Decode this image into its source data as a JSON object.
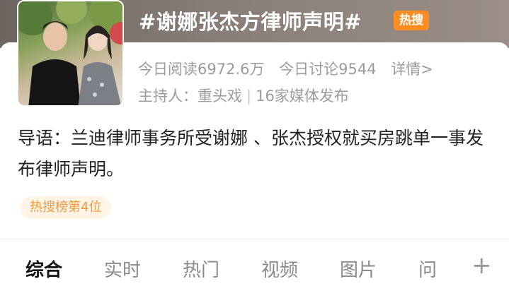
{
  "topic": {
    "title": "#谢娜张杰方律师声明#",
    "badge": "热搜"
  },
  "stats": {
    "reads": "今日阅读6972.6万",
    "discussions": "今日讨论9544",
    "detail_link": "详情>"
  },
  "host": {
    "label": "主持人：",
    "name": "重头戏",
    "separator": "|",
    "media": "16家媒体发布"
  },
  "intro": {
    "text": "导语：兰迪律师事务所受谢娜 、张杰授权就买房跳单一事发布律师声明。"
  },
  "rank_tag": "热搜榜第4位",
  "tabs": [
    {
      "label": "综合",
      "active": true
    },
    {
      "label": "实时",
      "active": false
    },
    {
      "label": "热门",
      "active": false
    },
    {
      "label": "视频",
      "active": false
    },
    {
      "label": "图片",
      "active": false
    },
    {
      "label": "问",
      "active": false
    }
  ],
  "more_icon": "plus-icon",
  "colors": {
    "badge": "#ff8d24",
    "rank_tag_text": "#f09a3a",
    "rank_tag_bg": "#fff4e6",
    "muted_text": "#9b9b9b"
  }
}
